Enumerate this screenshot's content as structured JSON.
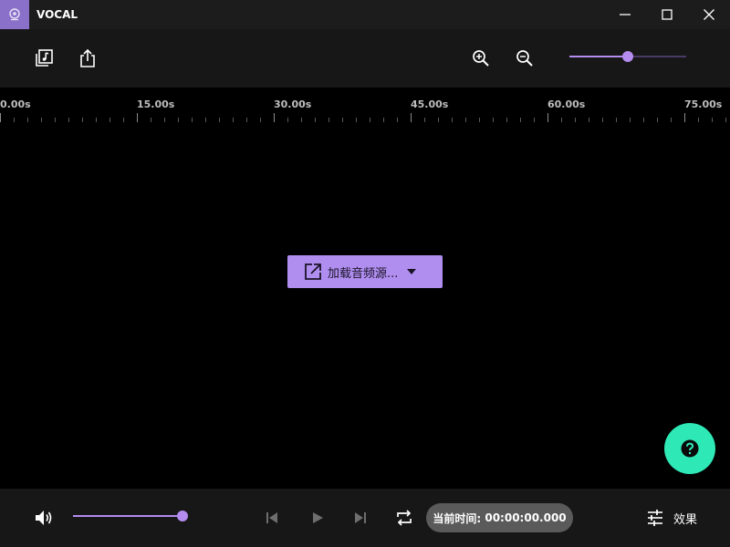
{
  "app": {
    "title": "VOCAL"
  },
  "colors": {
    "accent": "#b48cf0",
    "help": "#2ee8b6",
    "titlebar": "#1c1c1c",
    "toolbar": "#171717"
  },
  "titlebar": {
    "icons": [
      "minimize-icon",
      "maximize-icon",
      "close-icon"
    ]
  },
  "toolbar": {
    "buttons": [
      "music-library-icon",
      "export-icon",
      "zoom-in-icon",
      "zoom-out-icon"
    ],
    "zoom_level": 0.5
  },
  "timeline": {
    "labels": [
      "0.00s",
      "15.00s",
      "30.00s",
      "45.00s",
      "60.00s",
      "75.00s"
    ]
  },
  "main": {
    "load_audio_label": "加载音频源...",
    "help_icon": "question-icon"
  },
  "bottom": {
    "volume_level": 1.0,
    "current_time_label": "当前时间:",
    "current_time_value": "00:00:00.000",
    "effects_label": "效果"
  }
}
